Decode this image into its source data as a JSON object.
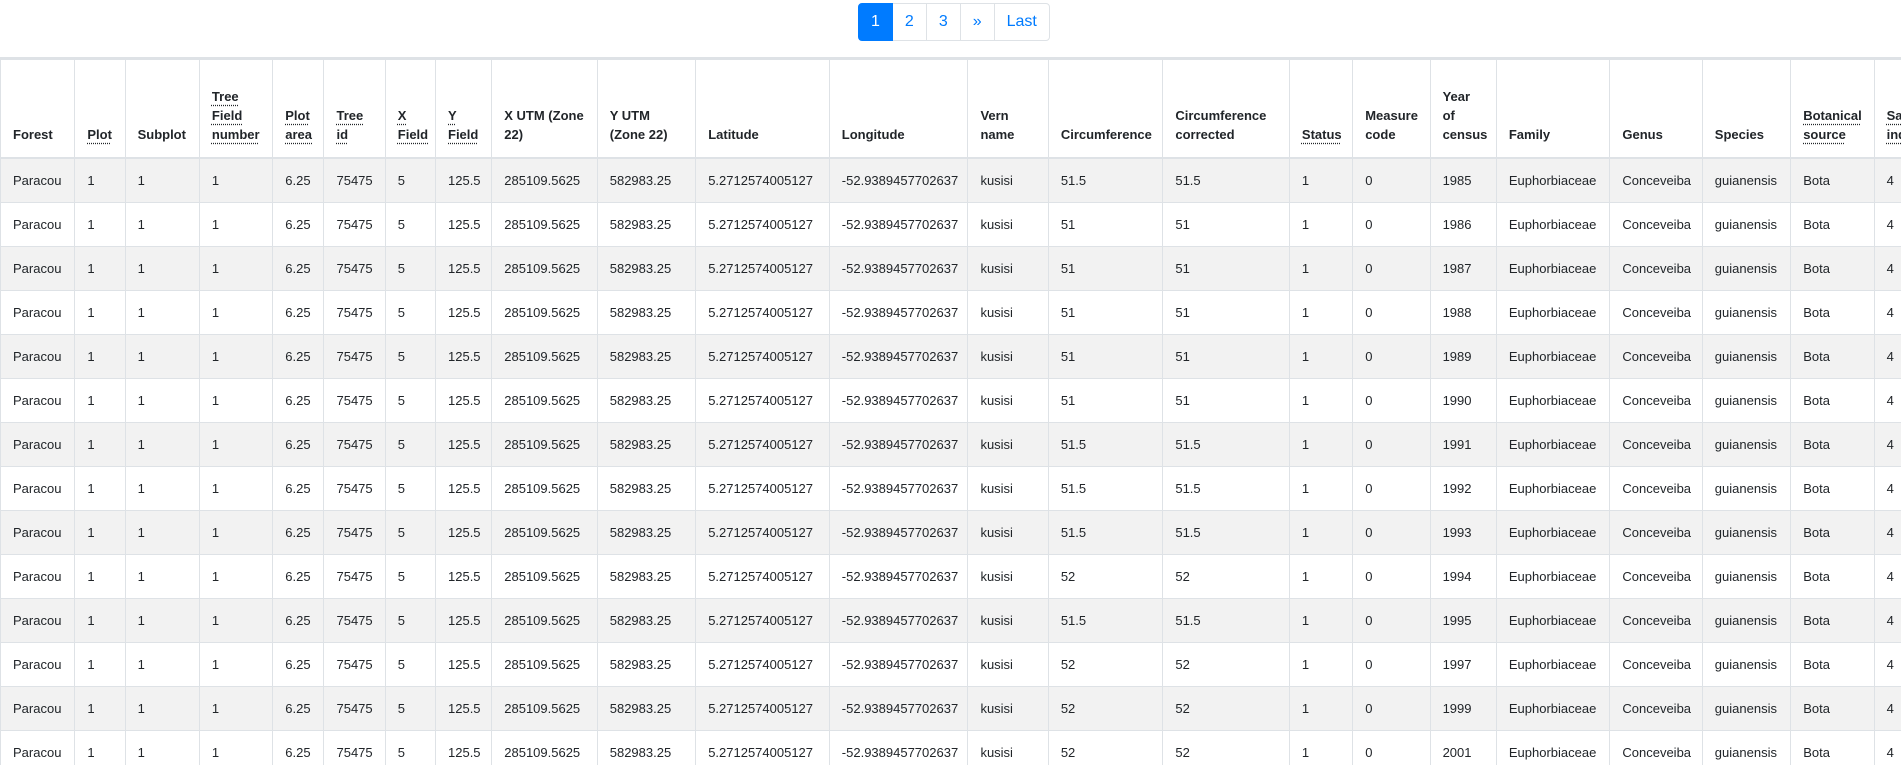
{
  "pagination": {
    "pages": [
      "1",
      "2",
      "3"
    ],
    "next": "»",
    "last": "Last",
    "active": "1"
  },
  "table": {
    "columns": [
      {
        "label": "Forest",
        "abbr": false
      },
      {
        "label": "Plot",
        "abbr": true
      },
      {
        "label": "Subplot",
        "abbr": false
      },
      {
        "label": "Tree Field number",
        "abbr": true
      },
      {
        "label": "Plot area",
        "abbr": true
      },
      {
        "label": "Tree id",
        "abbr": true
      },
      {
        "label": "X Field",
        "abbr": true
      },
      {
        "label": "Y Field",
        "abbr": true
      },
      {
        "label": "X UTM (Zone 22)",
        "abbr": false
      },
      {
        "label": "Y UTM (Zone 22)",
        "abbr": false
      },
      {
        "label": "Latitude",
        "abbr": false
      },
      {
        "label": "Longitude",
        "abbr": false
      },
      {
        "label": "Vern name",
        "abbr": false
      },
      {
        "label": "Circumference",
        "abbr": false
      },
      {
        "label": "Circumference corrected",
        "abbr": false
      },
      {
        "label": "Status",
        "abbr": true
      },
      {
        "label": "Measure code",
        "abbr": false
      },
      {
        "label": "Year of census",
        "abbr": false
      },
      {
        "label": "Family",
        "abbr": false
      },
      {
        "label": "Genus",
        "abbr": false
      },
      {
        "label": "Species",
        "abbr": false
      },
      {
        "label": "Botanical source",
        "abbr": true
      },
      {
        "label": "Safety index",
        "abbr": true
      }
    ],
    "rows": [
      [
        "Paracou",
        "1",
        "1",
        "1",
        "6.25",
        "75475",
        "5",
        "125.5",
        "285109.5625",
        "582983.25",
        "5.2712574005127",
        "-52.9389457702637",
        "kusisi",
        "51.5",
        "51.5",
        "1",
        "0",
        "1985",
        "Euphorbiaceae",
        "Conceveiba",
        "guianensis",
        "Bota",
        "4"
      ],
      [
        "Paracou",
        "1",
        "1",
        "1",
        "6.25",
        "75475",
        "5",
        "125.5",
        "285109.5625",
        "582983.25",
        "5.2712574005127",
        "-52.9389457702637",
        "kusisi",
        "51",
        "51",
        "1",
        "0",
        "1986",
        "Euphorbiaceae",
        "Conceveiba",
        "guianensis",
        "Bota",
        "4"
      ],
      [
        "Paracou",
        "1",
        "1",
        "1",
        "6.25",
        "75475",
        "5",
        "125.5",
        "285109.5625",
        "582983.25",
        "5.2712574005127",
        "-52.9389457702637",
        "kusisi",
        "51",
        "51",
        "1",
        "0",
        "1987",
        "Euphorbiaceae",
        "Conceveiba",
        "guianensis",
        "Bota",
        "4"
      ],
      [
        "Paracou",
        "1",
        "1",
        "1",
        "6.25",
        "75475",
        "5",
        "125.5",
        "285109.5625",
        "582983.25",
        "5.2712574005127",
        "-52.9389457702637",
        "kusisi",
        "51",
        "51",
        "1",
        "0",
        "1988",
        "Euphorbiaceae",
        "Conceveiba",
        "guianensis",
        "Bota",
        "4"
      ],
      [
        "Paracou",
        "1",
        "1",
        "1",
        "6.25",
        "75475",
        "5",
        "125.5",
        "285109.5625",
        "582983.25",
        "5.2712574005127",
        "-52.9389457702637",
        "kusisi",
        "51",
        "51",
        "1",
        "0",
        "1989",
        "Euphorbiaceae",
        "Conceveiba",
        "guianensis",
        "Bota",
        "4"
      ],
      [
        "Paracou",
        "1",
        "1",
        "1",
        "6.25",
        "75475",
        "5",
        "125.5",
        "285109.5625",
        "582983.25",
        "5.2712574005127",
        "-52.9389457702637",
        "kusisi",
        "51",
        "51",
        "1",
        "0",
        "1990",
        "Euphorbiaceae",
        "Conceveiba",
        "guianensis",
        "Bota",
        "4"
      ],
      [
        "Paracou",
        "1",
        "1",
        "1",
        "6.25",
        "75475",
        "5",
        "125.5",
        "285109.5625",
        "582983.25",
        "5.2712574005127",
        "-52.9389457702637",
        "kusisi",
        "51.5",
        "51.5",
        "1",
        "0",
        "1991",
        "Euphorbiaceae",
        "Conceveiba",
        "guianensis",
        "Bota",
        "4"
      ],
      [
        "Paracou",
        "1",
        "1",
        "1",
        "6.25",
        "75475",
        "5",
        "125.5",
        "285109.5625",
        "582983.25",
        "5.2712574005127",
        "-52.9389457702637",
        "kusisi",
        "51.5",
        "51.5",
        "1",
        "0",
        "1992",
        "Euphorbiaceae",
        "Conceveiba",
        "guianensis",
        "Bota",
        "4"
      ],
      [
        "Paracou",
        "1",
        "1",
        "1",
        "6.25",
        "75475",
        "5",
        "125.5",
        "285109.5625",
        "582983.25",
        "5.2712574005127",
        "-52.9389457702637",
        "kusisi",
        "51.5",
        "51.5",
        "1",
        "0",
        "1993",
        "Euphorbiaceae",
        "Conceveiba",
        "guianensis",
        "Bota",
        "4"
      ],
      [
        "Paracou",
        "1",
        "1",
        "1",
        "6.25",
        "75475",
        "5",
        "125.5",
        "285109.5625",
        "582983.25",
        "5.2712574005127",
        "-52.9389457702637",
        "kusisi",
        "52",
        "52",
        "1",
        "0",
        "1994",
        "Euphorbiaceae",
        "Conceveiba",
        "guianensis",
        "Bota",
        "4"
      ],
      [
        "Paracou",
        "1",
        "1",
        "1",
        "6.25",
        "75475",
        "5",
        "125.5",
        "285109.5625",
        "582983.25",
        "5.2712574005127",
        "-52.9389457702637",
        "kusisi",
        "51.5",
        "51.5",
        "1",
        "0",
        "1995",
        "Euphorbiaceae",
        "Conceveiba",
        "guianensis",
        "Bota",
        "4"
      ],
      [
        "Paracou",
        "1",
        "1",
        "1",
        "6.25",
        "75475",
        "5",
        "125.5",
        "285109.5625",
        "582983.25",
        "5.2712574005127",
        "-52.9389457702637",
        "kusisi",
        "52",
        "52",
        "1",
        "0",
        "1997",
        "Euphorbiaceae",
        "Conceveiba",
        "guianensis",
        "Bota",
        "4"
      ],
      [
        "Paracou",
        "1",
        "1",
        "1",
        "6.25",
        "75475",
        "5",
        "125.5",
        "285109.5625",
        "582983.25",
        "5.2712574005127",
        "-52.9389457702637",
        "kusisi",
        "52",
        "52",
        "1",
        "0",
        "1999",
        "Euphorbiaceae",
        "Conceveiba",
        "guianensis",
        "Bota",
        "4"
      ],
      [
        "Paracou",
        "1",
        "1",
        "1",
        "6.25",
        "75475",
        "5",
        "125.5",
        "285109.5625",
        "582983.25",
        "5.2712574005127",
        "-52.9389457702637",
        "kusisi",
        "52",
        "52",
        "1",
        "0",
        "2001",
        "Euphorbiaceae",
        "Conceveiba",
        "guianensis",
        "Bota",
        "4"
      ]
    ]
  }
}
